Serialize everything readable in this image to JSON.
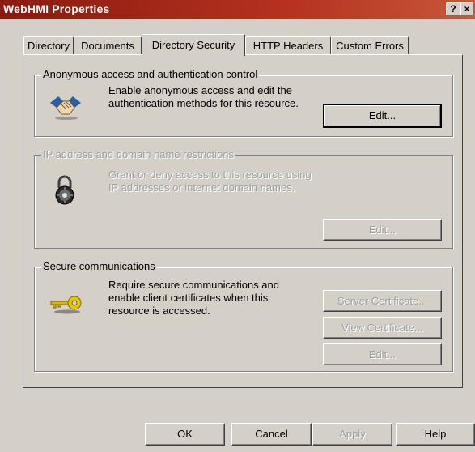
{
  "window": {
    "title": "WebHMI Properties",
    "help_glyph": "?",
    "close_glyph": "×"
  },
  "tabs": [
    {
      "label": "Directory"
    },
    {
      "label": "Documents"
    },
    {
      "label": "Directory Security"
    },
    {
      "label": "HTTP Headers"
    },
    {
      "label": "Custom Errors"
    }
  ],
  "anonymous": {
    "legend": "Anonymous access and authentication control",
    "description": "Enable anonymous access and edit the\nauthentication methods for this resource.",
    "edit_label": "Edit...",
    "icon": "handshake-icon"
  },
  "ip": {
    "legend": "IP address and domain name restrictions",
    "description": "Grant or deny access to this resource using\nIP addresses or internet domain names.",
    "edit_label": "Edit...",
    "icon": "padlock-icon"
  },
  "secure": {
    "legend": "Secure communications",
    "description": "Require secure communications and\nenable client certificates when this\nresource is accessed.",
    "server_cert_label": "Server Certificate...",
    "view_cert_label": "View Certificate...",
    "edit_label": "Edit...",
    "icon": "key-icon"
  },
  "footer": {
    "ok_label": "OK",
    "cancel_label": "Cancel",
    "apply_label": "Apply",
    "help_label": "Help"
  },
  "colors": {
    "titlebar": "#8b1a10",
    "face": "#d4d0c8",
    "disabled_text": "#a0a0a0"
  }
}
